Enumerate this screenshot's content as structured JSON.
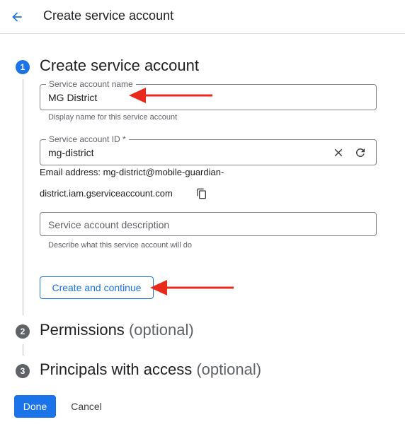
{
  "header": {
    "back_icon": "arrow-back-icon",
    "title": "Create service account"
  },
  "steps": [
    {
      "number": "1",
      "title": "Create service account",
      "optional": ""
    },
    {
      "number": "2",
      "title": "Permissions",
      "optional": "(optional)"
    },
    {
      "number": "3",
      "title": "Principals with access",
      "optional": "(optional)"
    }
  ],
  "form": {
    "name": {
      "label": "Service account name",
      "value": "MG District",
      "hint": "Display name for this service account"
    },
    "id": {
      "label": "Service account ID *",
      "value": "mg-district",
      "clear_icon": "close-icon",
      "refresh_icon": "refresh-icon"
    },
    "email": {
      "line1": "Email address: mg-district@mobile-guardian-",
      "line2": "district.iam.gserviceaccount.com",
      "copy_icon": "copy-icon"
    },
    "description": {
      "placeholder": "Service account description",
      "hint": "Describe what this service account will do"
    }
  },
  "buttons": {
    "create_continue": "Create and continue",
    "done": "Done",
    "cancel": "Cancel"
  },
  "colors": {
    "accent": "#1a73e8",
    "annotation_arrow": "#e8291c",
    "inactive_step": "#5f6368"
  }
}
